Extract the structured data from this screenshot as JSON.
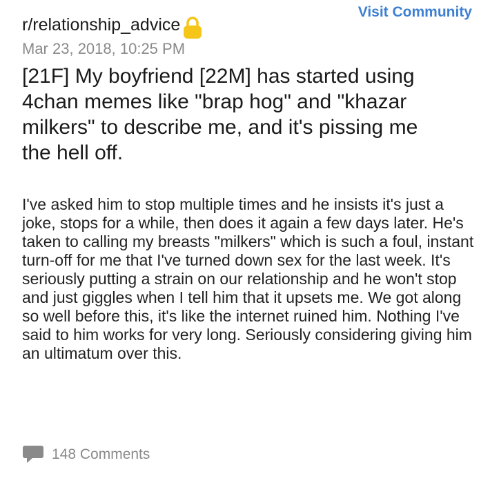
{
  "header": {
    "visit_community_label": "Visit Community",
    "subreddit": "r/relationship_advice",
    "timestamp": "Mar 23, 2018, 10:25 PM",
    "lock_icon": "lock-icon",
    "lock_color": "#f5c518"
  },
  "post": {
    "title": "[21F] My boyfriend [22M] has started using 4chan memes like \"brap hog\" and \"khazar milkers\" to describe me, and it's pissing me the hell off.",
    "body": "I've asked him to stop multiple times and he insists it's just a joke, stops for a while, then does it again a few days later. He's taken to calling my breasts \"milkers\" which is such a foul, instant turn-off for me that I've turned down sex for the last week. It's seriously putting a strain on our relationship and he won't stop and just giggles when I tell him that it upsets me. We got along so well before this, it's like the internet ruined him. Nothing I've said to him works for very long. Seriously considering giving him an ultimatum over this."
  },
  "footer": {
    "comments_icon": "comment-bubble-icon",
    "comments_label": "148 Comments"
  },
  "colors": {
    "link": "#3d7fd3",
    "muted": "#8a8a8a",
    "text": "#1a1a1b"
  }
}
